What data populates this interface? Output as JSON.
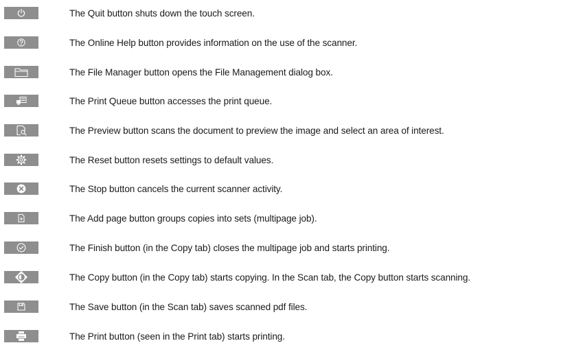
{
  "buttons": [
    {
      "icon": "power-icon",
      "description": "The Quit button shuts down the touch screen."
    },
    {
      "icon": "help-icon",
      "description": "The Online Help button provides information on the use of the scanner."
    },
    {
      "icon": "folder-icon",
      "description": "The File Manager button opens the File Management dialog box."
    },
    {
      "icon": "print-queue-icon",
      "description": "The Print Queue button accesses the print queue."
    },
    {
      "icon": "preview-icon",
      "description": "The Preview button scans the document to preview the image and select an area of interest."
    },
    {
      "icon": "gear-icon",
      "description": "The Reset button resets settings to default values."
    },
    {
      "icon": "stop-icon",
      "description": "The Stop button cancels the current scanner activity."
    },
    {
      "icon": "add-page-icon",
      "description": "The Add page button groups copies into sets (multipage job)."
    },
    {
      "icon": "check-circle-icon",
      "description": "The Finish button (in the Copy tab) closes the multipage job and starts printing."
    },
    {
      "icon": "copy-diamond-icon",
      "description": "The Copy button (in the Copy tab) starts copying. In the Scan tab, the Copy button starts scanning."
    },
    {
      "icon": "save-icon",
      "description": "The Save button (in the Scan tab) saves scanned pdf files."
    },
    {
      "icon": "printer-icon",
      "description": "The Print button (seen in the Print tab) starts printing."
    }
  ],
  "colors": {
    "button_background": "#8e8e8e",
    "icon": "#ffffff",
    "text": "#1a1a1a"
  }
}
